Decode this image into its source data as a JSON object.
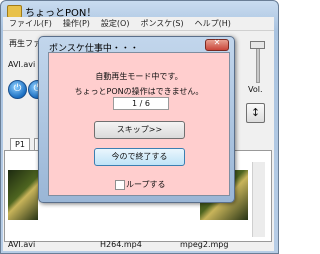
{
  "app": {
    "title": "ちょっとPON！"
  },
  "menu": [
    {
      "label": "ファイル(F)"
    },
    {
      "label": "操作(P)"
    },
    {
      "label": "設定(O)"
    },
    {
      "label": "ポンスケ(S)"
    },
    {
      "label": "ヘルプ(H)"
    }
  ],
  "player": {
    "play_file_label": "再生ファイル",
    "current_file": "AVI.avi",
    "volume_label": "Vol."
  },
  "tabs": [
    {
      "label": "P1"
    },
    {
      "label": "P"
    }
  ],
  "playlist": [
    {
      "file": "AVI.avi"
    },
    {
      "file": "H264.mp4"
    },
    {
      "file": "mpeg2.mpg"
    }
  ],
  "dialog": {
    "title": "ポンスケ仕事中・・・",
    "message_line1": "自動再生モード中です。",
    "message_line2": "ちょっとPONの操作はできません。",
    "counter": "1 / 6",
    "skip_label": "スキップ>>",
    "stop_label": "今ので終了する",
    "loop_label": "ループする",
    "loop_checked": false
  },
  "colors": {
    "dialog_body": "#ffcece",
    "window_frame": "#b9d1ea",
    "accent_button": "#1b6fc2"
  }
}
